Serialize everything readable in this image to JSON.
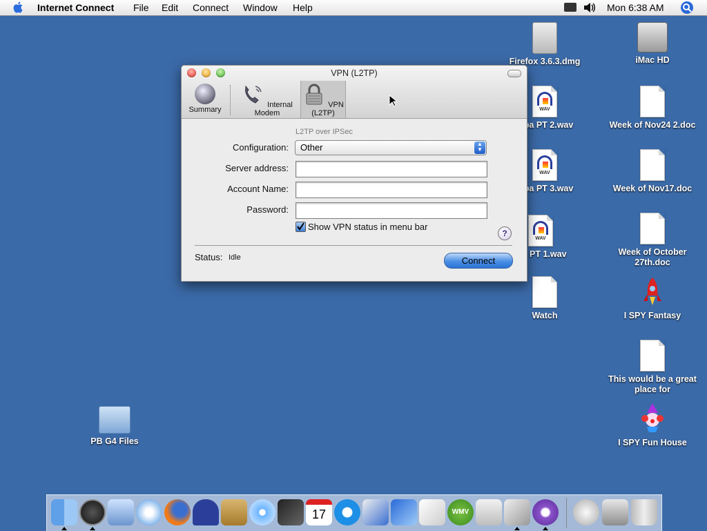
{
  "menubar": {
    "app_name": "Internet Connect",
    "items": [
      "File",
      "Edit",
      "Connect",
      "Window",
      "Help"
    ],
    "clock": "Mon 6:38 AM"
  },
  "desktop_icons": {
    "firefox_dmg": "Firefox 3.6.3.dmg",
    "imac_hd": "iMac HD",
    "wav_2": "niba PT 2.wav",
    "week_nov24": "Week of Nov24 2.doc",
    "wav_3": "niba PT 3.wav",
    "week_nov17": "Week of Nov17.doc",
    "wav_1": "iba PT 1.wav",
    "week_oct27": "Week of October 27th.doc",
    "watch": "Watch",
    "ispy_fantasy": "I SPY Fantasy",
    "great_place": "This would be a great place for",
    "ispy_funhouse": "I SPY Fun House",
    "pb_g4": "PB G4 Files",
    "wav_tag": "WAV"
  },
  "window": {
    "title": "VPN (L2TP)",
    "toolbar": [
      "Summary",
      "Internal Modem",
      "VPN (L2TP)"
    ],
    "subtitle": "L2TP over IPSec",
    "config_label": "Configuration:",
    "config_value": "Other",
    "server_label": "Server address:",
    "server_value": "",
    "account_label": "Account Name:",
    "account_value": "",
    "password_label": "Password:",
    "password_value": "",
    "show_status_label": "Show VPN status in menu bar",
    "show_status_checked": true,
    "status_label": "Status:",
    "status_value": "Idle",
    "connect_label": "Connect",
    "help_label": "?"
  },
  "dock": {
    "calendar_day": "17",
    "wmv_label": "WMV"
  }
}
